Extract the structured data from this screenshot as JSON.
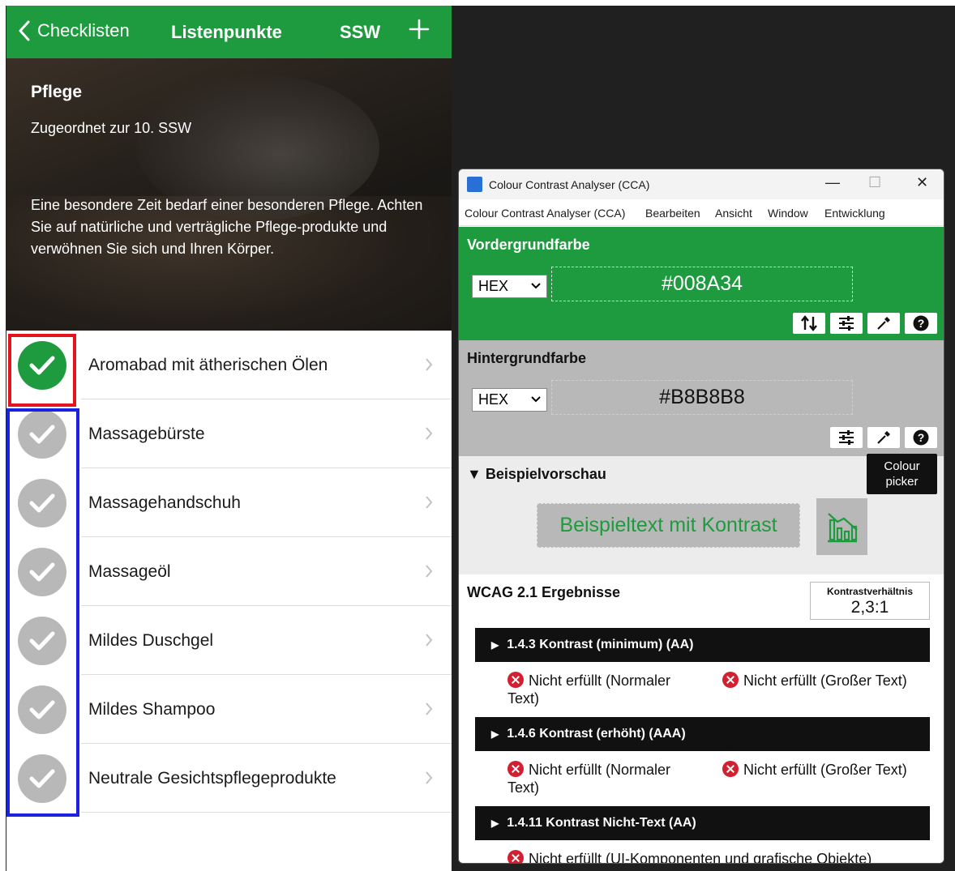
{
  "app": {
    "topbar": {
      "back_label": "Checklisten",
      "title": "Listenpunkte",
      "ssw_label": "SSW",
      "add_icon": "plus-icon"
    },
    "hero": {
      "title": "Pflege",
      "subtitle": "Zugeordnet zur 10. SSW",
      "description": "Eine besondere Zeit bedarf einer besonderen Pflege. Achten Sie auf natürliche und verträgliche Pflege-produkte und verwöhnen Sie sich und Ihren Körper."
    },
    "items": [
      {
        "label": "Aromabad mit ätherischen Ölen",
        "checked": true
      },
      {
        "label": "Massagebürste",
        "checked": false
      },
      {
        "label": "Massagehandschuh",
        "checked": false
      },
      {
        "label": "Massageöl",
        "checked": false
      },
      {
        "label": "Mildes Duschgel",
        "checked": false
      },
      {
        "label": "Mildes Shampoo",
        "checked": false
      },
      {
        "label": "Neutrale Gesichtspflegeprodukte",
        "checked": false
      }
    ],
    "colors": {
      "checked": "#1e9b3e",
      "unchecked": "#b8b8b8",
      "highlight_checked": "#e4141c",
      "highlight_unchecked": "#1a22e0"
    }
  },
  "cca": {
    "window_title": "Colour Contrast Analyser (CCA)",
    "menu": [
      "Colour Contrast Analyser (CCA)",
      "Bearbeiten",
      "Ansicht",
      "Window",
      "Entwicklung"
    ],
    "foreground": {
      "label": "Vordergrundfarbe",
      "format": "HEX",
      "value": "#008A34"
    },
    "background": {
      "label": "Hintergrundfarbe",
      "format": "HEX",
      "value": "#B8B8B8"
    },
    "preview": {
      "label": "Beispielvorschau",
      "sample_text": "Beispieltext mit Kontrast"
    },
    "tooltip": {
      "line1": "Colour",
      "line2": "picker"
    },
    "results": {
      "label": "WCAG 2.1 Ergebnisse",
      "ratio_label": "Kontrastverhältnis",
      "ratio_value": "2,3:1",
      "criteria": [
        {
          "title": "1.4.3 Kontrast (minimum) (AA)",
          "normal": "Nicht erfüllt (Normaler Text)",
          "large": "Nicht erfüllt (Großer Text)"
        },
        {
          "title": "1.4.6 Kontrast (erhöht) (AAA)",
          "normal": "Nicht erfüllt (Normaler Text)",
          "large": "Nicht erfüllt (Großer Text)"
        },
        {
          "title": "1.4.11 Kontrast Nicht-Text (AA)",
          "ui": "Nicht erfüllt (UI-Komponenten und grafische Objekte)"
        }
      ]
    },
    "colors": {
      "foreground_panel": "#1e9b3e",
      "background_panel": "#b8b8b8",
      "fail": "#d32030"
    }
  }
}
